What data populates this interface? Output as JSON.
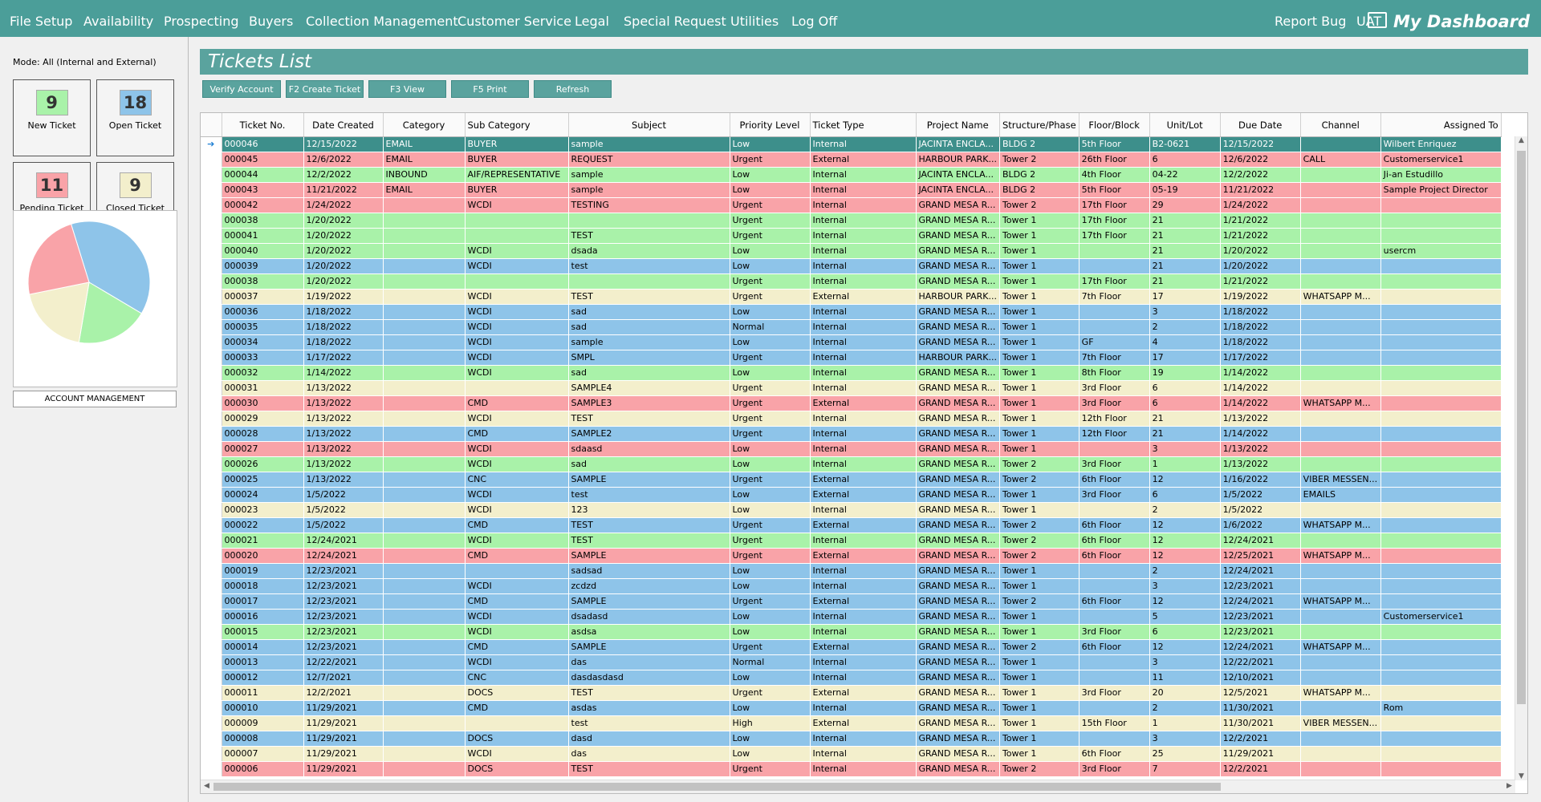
{
  "menu": {
    "items": [
      "File Setup",
      "Availability",
      "Prospecting",
      "Buyers",
      "Collection Management",
      "Customer Service",
      "Legal",
      "Special Request",
      "Utilities",
      "Log Off"
    ],
    "report_bug": "Report Bug",
    "env": "UAT",
    "dashboard": "My Dashboard"
  },
  "sidebar": {
    "mode": "Mode: All (Internal and External)",
    "cards": [
      {
        "value": "9",
        "label": "New Ticket",
        "color": "#a9f2a9"
      },
      {
        "value": "18",
        "label": "Open Ticket",
        "color": "#8ec4e9"
      },
      {
        "value": "11",
        "label": "Pending Ticket",
        "color": "#f9a3a8"
      },
      {
        "value": "9",
        "label": "Closed Ticket",
        "color": "#f3efcc"
      }
    ],
    "account_management": "ACCOUNT MANAGEMENT"
  },
  "chart_data": {
    "type": "pie",
    "labels": [
      "Open Ticket",
      "New Ticket",
      "Closed Ticket",
      "Pending Ticket"
    ],
    "values": [
      18,
      9,
      9,
      11
    ],
    "colors": [
      "#8ec4e9",
      "#a9f2a9",
      "#f3efcc",
      "#f9a3a8"
    ]
  },
  "main": {
    "title": "Tickets List",
    "toolbar": [
      "Verify Account",
      "F2  Create Ticket",
      "F3   View",
      "F5  Print",
      "Refresh"
    ],
    "columns": [
      "Ticket No.",
      "Date Created",
      "Category",
      "Sub Category",
      "Subject",
      "Priority Level",
      "Ticket Type",
      "Project Name",
      "Structure/Phase",
      "Floor/Block",
      "Unit/Lot",
      "Due Date",
      "Channel",
      "Assigned To"
    ],
    "rows": [
      {
        "c": "sel",
        "v": [
          "000046",
          "12/15/2022",
          "EMAIL",
          "BUYER",
          "sample",
          "Low",
          "Internal",
          "JACINTA ENCLA...",
          "BLDG 2",
          "5th Floor",
          "B2-0621",
          "12/15/2022",
          "",
          "Wilbert Enriquez"
        ]
      },
      {
        "c": "red",
        "v": [
          "000045",
          "12/6/2022",
          "EMAIL",
          "BUYER",
          "REQUEST",
          "Urgent",
          "External",
          "HARBOUR PARK...",
          "Tower 2",
          "26th Floor",
          "6",
          "12/6/2022",
          "CALL",
          "Customerservice1"
        ]
      },
      {
        "c": "green",
        "v": [
          "000044",
          "12/2/2022",
          "INBOUND",
          "AIF/REPRESENTATIVE",
          "sample",
          "Low",
          "Internal",
          "JACINTA ENCLA...",
          "BLDG 2",
          "4th Floor",
          "04-22",
          "12/2/2022",
          "",
          "Ji-an Estudillo"
        ]
      },
      {
        "c": "red",
        "v": [
          "000043",
          "11/21/2022",
          "EMAIL",
          "BUYER",
          "sample",
          "Low",
          "Internal",
          "JACINTA ENCLA...",
          "BLDG 2",
          "5th Floor",
          "05-19",
          "11/21/2022",
          "",
          "Sample Project Director"
        ]
      },
      {
        "c": "red",
        "v": [
          "000042",
          "1/24/2022",
          "",
          "WCDI",
          "TESTING",
          "Urgent",
          "Internal",
          "GRAND MESA R...",
          "Tower 2",
          "17th Floor",
          "29",
          "1/24/2022",
          "",
          ""
        ]
      },
      {
        "c": "green",
        "v": [
          "000038",
          "1/20/2022",
          "",
          "",
          "",
          "Urgent",
          "Internal",
          "GRAND MESA R...",
          "Tower 1",
          "17th Floor",
          "21",
          "1/21/2022",
          "",
          ""
        ]
      },
      {
        "c": "green",
        "v": [
          "000041",
          "1/20/2022",
          "",
          "",
          "TEST",
          "Urgent",
          "Internal",
          "GRAND MESA R...",
          "Tower 1",
          "17th Floor",
          "21",
          "1/21/2022",
          "",
          ""
        ]
      },
      {
        "c": "green",
        "v": [
          "000040",
          "1/20/2022",
          "",
          "WCDI",
          "dsada",
          "Low",
          "Internal",
          "GRAND MESA R...",
          "Tower 1",
          "",
          "21",
          "1/20/2022",
          "",
          "usercm"
        ]
      },
      {
        "c": "blue",
        "v": [
          "000039",
          "1/20/2022",
          "",
          "WCDI",
          "test",
          "Low",
          "Internal",
          "GRAND MESA R...",
          "Tower 1",
          "",
          "21",
          "1/20/2022",
          "",
          ""
        ]
      },
      {
        "c": "green",
        "v": [
          "000038",
          "1/20/2022",
          "",
          "",
          "",
          "Urgent",
          "Internal",
          "GRAND MESA R...",
          "Tower 1",
          "17th Floor",
          "21",
          "1/21/2022",
          "",
          ""
        ]
      },
      {
        "c": "cream",
        "v": [
          "000037",
          "1/19/2022",
          "",
          "WCDI",
          "TEST",
          "Urgent",
          "External",
          "HARBOUR PARK...",
          "Tower 1",
          "7th Floor",
          "17",
          "1/19/2022",
          "WHATSAPP M...",
          ""
        ]
      },
      {
        "c": "blue",
        "v": [
          "000036",
          "1/18/2022",
          "",
          "WCDI",
          "sad",
          "Low",
          "Internal",
          "GRAND MESA R...",
          "Tower 1",
          "",
          "3",
          "1/18/2022",
          "",
          ""
        ]
      },
      {
        "c": "blue",
        "v": [
          "000035",
          "1/18/2022",
          "",
          "WCDI",
          "sad",
          "Normal",
          "Internal",
          "GRAND MESA R...",
          "Tower 1",
          "",
          "2",
          "1/18/2022",
          "",
          ""
        ]
      },
      {
        "c": "blue",
        "v": [
          "000034",
          "1/18/2022",
          "",
          "WCDI",
          "sample",
          "Low",
          "Internal",
          "GRAND MESA R...",
          "Tower 1",
          "GF",
          "4",
          "1/18/2022",
          "",
          ""
        ]
      },
      {
        "c": "blue",
        "v": [
          "000033",
          "1/17/2022",
          "",
          "WCDI",
          "SMPL",
          "Urgent",
          "Internal",
          "HARBOUR PARK...",
          "Tower 1",
          "7th Floor",
          "17",
          "1/17/2022",
          "",
          ""
        ]
      },
      {
        "c": "green",
        "v": [
          "000032",
          "1/14/2022",
          "",
          "WCDI",
          "sad",
          "Low",
          "Internal",
          "GRAND MESA R...",
          "Tower 1",
          "8th Floor",
          "19",
          "1/14/2022",
          "",
          ""
        ]
      },
      {
        "c": "cream",
        "v": [
          "000031",
          "1/13/2022",
          "",
          "",
          "SAMPLE4",
          "Urgent",
          "Internal",
          "GRAND MESA R...",
          "Tower 1",
          "3rd Floor",
          "6",
          "1/14/2022",
          "",
          ""
        ]
      },
      {
        "c": "red",
        "v": [
          "000030",
          "1/13/2022",
          "",
          "CMD",
          "SAMPLE3",
          "Urgent",
          "External",
          "GRAND MESA R...",
          "Tower 1",
          "3rd Floor",
          "6",
          "1/14/2022",
          "WHATSAPP M...",
          ""
        ]
      },
      {
        "c": "cream",
        "v": [
          "000029",
          "1/13/2022",
          "",
          "WCDI",
          "TEST",
          "Urgent",
          "Internal",
          "GRAND MESA R...",
          "Tower 1",
          "12th Floor",
          "21",
          "1/13/2022",
          "",
          ""
        ]
      },
      {
        "c": "blue",
        "v": [
          "000028",
          "1/13/2022",
          "",
          "CMD",
          "SAMPLE2",
          "Urgent",
          "Internal",
          "GRAND MESA R...",
          "Tower 1",
          "12th Floor",
          "21",
          "1/14/2022",
          "",
          ""
        ]
      },
      {
        "c": "red",
        "v": [
          "000027",
          "1/13/2022",
          "",
          "WCDI",
          "sdaasd",
          "Low",
          "Internal",
          "GRAND MESA R...",
          "Tower 1",
          "",
          "3",
          "1/13/2022",
          "",
          ""
        ]
      },
      {
        "c": "green",
        "v": [
          "000026",
          "1/13/2022",
          "",
          "WCDI",
          "sad",
          "Low",
          "Internal",
          "GRAND MESA R...",
          "Tower 2",
          "3rd Floor",
          "1",
          "1/13/2022",
          "",
          ""
        ]
      },
      {
        "c": "blue",
        "v": [
          "000025",
          "1/13/2022",
          "",
          "CNC",
          "SAMPLE",
          "Urgent",
          "External",
          "GRAND MESA R...",
          "Tower 2",
          "6th Floor",
          "12",
          "1/16/2022",
          "VIBER MESSEN...",
          ""
        ]
      },
      {
        "c": "blue",
        "v": [
          "000024",
          "1/5/2022",
          "",
          "WCDI",
          "test",
          "Low",
          "External",
          "GRAND MESA R...",
          "Tower 1",
          "3rd Floor",
          "6",
          "1/5/2022",
          "EMAILS",
          ""
        ]
      },
      {
        "c": "cream",
        "v": [
          "000023",
          "1/5/2022",
          "",
          "WCDI",
          "123",
          "Low",
          "Internal",
          "GRAND MESA R...",
          "Tower 1",
          "",
          "2",
          "1/5/2022",
          "",
          ""
        ]
      },
      {
        "c": "blue",
        "v": [
          "000022",
          "1/5/2022",
          "",
          "CMD",
          "TEST",
          "Urgent",
          "External",
          "GRAND MESA R...",
          "Tower 2",
          "6th Floor",
          "12",
          "1/6/2022",
          "WHATSAPP M...",
          ""
        ]
      },
      {
        "c": "green",
        "v": [
          "000021",
          "12/24/2021",
          "",
          "WCDI",
          "TEST",
          "Urgent",
          "Internal",
          "GRAND MESA R...",
          "Tower 2",
          "6th Floor",
          "12",
          "12/24/2021",
          "",
          ""
        ]
      },
      {
        "c": "red",
        "v": [
          "000020",
          "12/24/2021",
          "",
          "CMD",
          "SAMPLE",
          "Urgent",
          "External",
          "GRAND MESA R...",
          "Tower 2",
          "6th Floor",
          "12",
          "12/25/2021",
          "WHATSAPP M...",
          ""
        ]
      },
      {
        "c": "blue",
        "v": [
          "000019",
          "12/23/2021",
          "",
          "",
          "sadsad",
          "Low",
          "Internal",
          "GRAND MESA R...",
          "Tower 1",
          "",
          "2",
          "12/24/2021",
          "",
          ""
        ]
      },
      {
        "c": "blue",
        "v": [
          "000018",
          "12/23/2021",
          "",
          "WCDI",
          "zcdzd",
          "Low",
          "Internal",
          "GRAND MESA R...",
          "Tower 1",
          "",
          "3",
          "12/23/2021",
          "",
          ""
        ]
      },
      {
        "c": "blue",
        "v": [
          "000017",
          "12/23/2021",
          "",
          "CMD",
          "SAMPLE",
          "Urgent",
          "External",
          "GRAND MESA R...",
          "Tower 2",
          "6th Floor",
          "12",
          "12/24/2021",
          "WHATSAPP M...",
          ""
        ]
      },
      {
        "c": "blue",
        "v": [
          "000016",
          "12/23/2021",
          "",
          "WCDI",
          "dsadasd",
          "Low",
          "Internal",
          "GRAND MESA R...",
          "Tower 1",
          "",
          "5",
          "12/23/2021",
          "",
          "Customerservice1"
        ]
      },
      {
        "c": "green",
        "v": [
          "000015",
          "12/23/2021",
          "",
          "WCDI",
          "asdsa",
          "Low",
          "Internal",
          "GRAND MESA R...",
          "Tower 1",
          "3rd Floor",
          "6",
          "12/23/2021",
          "",
          ""
        ]
      },
      {
        "c": "blue",
        "v": [
          "000014",
          "12/23/2021",
          "",
          "CMD",
          "SAMPLE",
          "Urgent",
          "External",
          "GRAND MESA R...",
          "Tower 2",
          "6th Floor",
          "12",
          "12/24/2021",
          "WHATSAPP M...",
          ""
        ]
      },
      {
        "c": "blue",
        "v": [
          "000013",
          "12/22/2021",
          "",
          "WCDI",
          "das",
          "Normal",
          "Internal",
          "GRAND MESA R...",
          "Tower 1",
          "",
          "3",
          "12/22/2021",
          "",
          ""
        ]
      },
      {
        "c": "blue",
        "v": [
          "000012",
          "12/7/2021",
          "",
          "CNC",
          "dasdasdasd",
          "Low",
          "Internal",
          "GRAND MESA R...",
          "Tower 1",
          "",
          "11",
          "12/10/2021",
          "",
          ""
        ]
      },
      {
        "c": "cream",
        "v": [
          "000011",
          "12/2/2021",
          "",
          "DOCS",
          "TEST",
          "Urgent",
          "External",
          "GRAND MESA R...",
          "Tower 1",
          "3rd Floor",
          "20",
          "12/5/2021",
          "WHATSAPP M...",
          ""
        ]
      },
      {
        "c": "blue",
        "v": [
          "000010",
          "11/29/2021",
          "",
          "CMD",
          "asdas",
          "Low",
          "Internal",
          "GRAND MESA R...",
          "Tower 1",
          "",
          "2",
          "11/30/2021",
          "",
          "Rom"
        ]
      },
      {
        "c": "cream",
        "v": [
          "000009",
          "11/29/2021",
          "",
          "",
          "test",
          "High",
          "External",
          "GRAND MESA R...",
          "Tower 1",
          "15th Floor",
          "1",
          "11/30/2021",
          "VIBER MESSEN...",
          ""
        ]
      },
      {
        "c": "blue",
        "v": [
          "000008",
          "11/29/2021",
          "",
          "DOCS",
          "dasd",
          "Low",
          "Internal",
          "GRAND MESA R...",
          "Tower 1",
          "",
          "3",
          "12/2/2021",
          "",
          ""
        ]
      },
      {
        "c": "cream",
        "v": [
          "000007",
          "11/29/2021",
          "",
          "WCDI",
          "das",
          "Low",
          "Internal",
          "GRAND MESA R...",
          "Tower 1",
          "6th Floor",
          "25",
          "11/29/2021",
          "",
          ""
        ]
      },
      {
        "c": "red",
        "v": [
          "000006",
          "11/29/2021",
          "",
          "DOCS",
          "TEST",
          "Urgent",
          "Internal",
          "GRAND MESA R...",
          "Tower 2",
          "3rd Floor",
          "7",
          "12/2/2021",
          "",
          ""
        ]
      }
    ]
  }
}
